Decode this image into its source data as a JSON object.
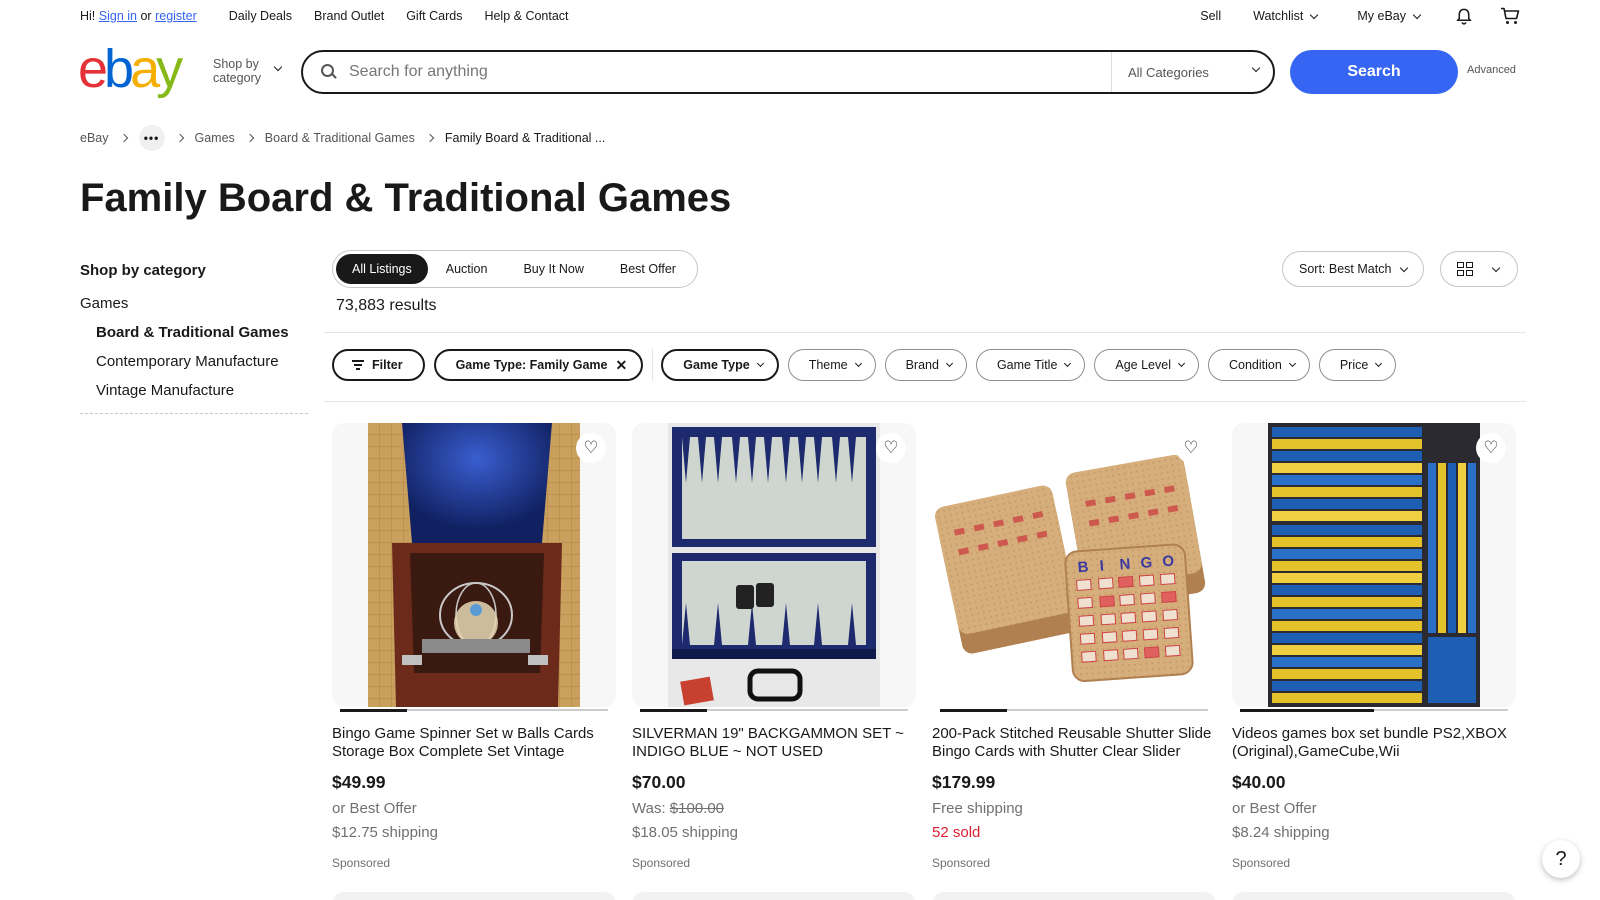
{
  "topnav": {
    "greeting": "Hi!",
    "sign_in": "Sign in",
    "or": "or",
    "register": "register",
    "links": [
      "Daily Deals",
      "Brand Outlet",
      "Gift Cards",
      "Help & Contact"
    ],
    "sell": "Sell",
    "watchlist": "Watchlist",
    "my_ebay": "My eBay"
  },
  "header": {
    "logo": [
      "e",
      "b",
      "a",
      "y"
    ],
    "shop_by_line1": "Shop by",
    "shop_by_line2": "category",
    "search_placeholder": "Search for anything",
    "category_select": "All Categories",
    "search_button": "Search",
    "advanced": "Advanced"
  },
  "breadcrumb": {
    "items": [
      "eBay",
      "Games",
      "Board & Traditional Games",
      "Family Board & Traditional ..."
    ]
  },
  "page_title": "Family Board & Traditional Games",
  "sidebar": {
    "heading": "Shop by category",
    "root": "Games",
    "items": [
      {
        "label": "Board & Traditional Games",
        "selected": true
      },
      {
        "label": "Contemporary Manufacture",
        "selected": false
      },
      {
        "label": "Vintage Manufacture",
        "selected": false
      }
    ]
  },
  "tabs": [
    "All Listings",
    "Auction",
    "Buy It Now",
    "Best Offer"
  ],
  "results": "73,883 results",
  "sort": "Sort: Best Match",
  "filters": {
    "filter_label": "Filter",
    "applied": "Game Type: Family Game",
    "buttons": [
      "Game Type",
      "Theme",
      "Brand",
      "Game Title",
      "Age Level",
      "Condition",
      "Price"
    ]
  },
  "listings": [
    {
      "title": "Bingo Game Spinner Set w Balls Cards Storage Box Complete Set Vintage",
      "price": "$49.99",
      "line1": "or Best Offer",
      "line2": "$12.75 shipping",
      "sponsored": "Sponsored",
      "image_progress": 0.25
    },
    {
      "title": "SILVERMAN 19\" BACKGAMMON SET ~ INDIGO BLUE ~ NOT USED",
      "price": "$70.00",
      "was_label": "Was:",
      "was_price": "$100.00",
      "line2": "$18.05 shipping",
      "sponsored": "Sponsored",
      "image_progress": 0.25
    },
    {
      "title": "200-Pack Stitched Reusable Shutter Slide Bingo Cards with Shutter Clear Slider",
      "price": "$179.99",
      "line1": "Free shipping",
      "line2": "52 sold",
      "sponsored": "Sponsored",
      "image_progress": 0.25
    },
    {
      "title": "Videos games box set bundle PS2,XBOX (Original),GameCube,Wii",
      "price": "$40.00",
      "line1": "or Best Offer",
      "line2": "$8.24 shipping",
      "sponsored": "Sponsored",
      "image_progress": 0.5
    }
  ],
  "bingo_letters": [
    "B",
    "I",
    "N",
    "G",
    "O"
  ],
  "help": "?",
  "icons": [
    "chevron-down-icon",
    "bell-icon",
    "cart-icon",
    "search-icon",
    "grid-view-icon",
    "filter-icon",
    "close-icon",
    "heart-icon",
    "help-icon"
  ],
  "colors": {
    "accent": "#3665f3",
    "logo_e": "#e53238",
    "logo_b": "#0064d2",
    "logo_a": "#f5af02",
    "logo_y": "#86b817",
    "sold": "#dd1e31"
  }
}
